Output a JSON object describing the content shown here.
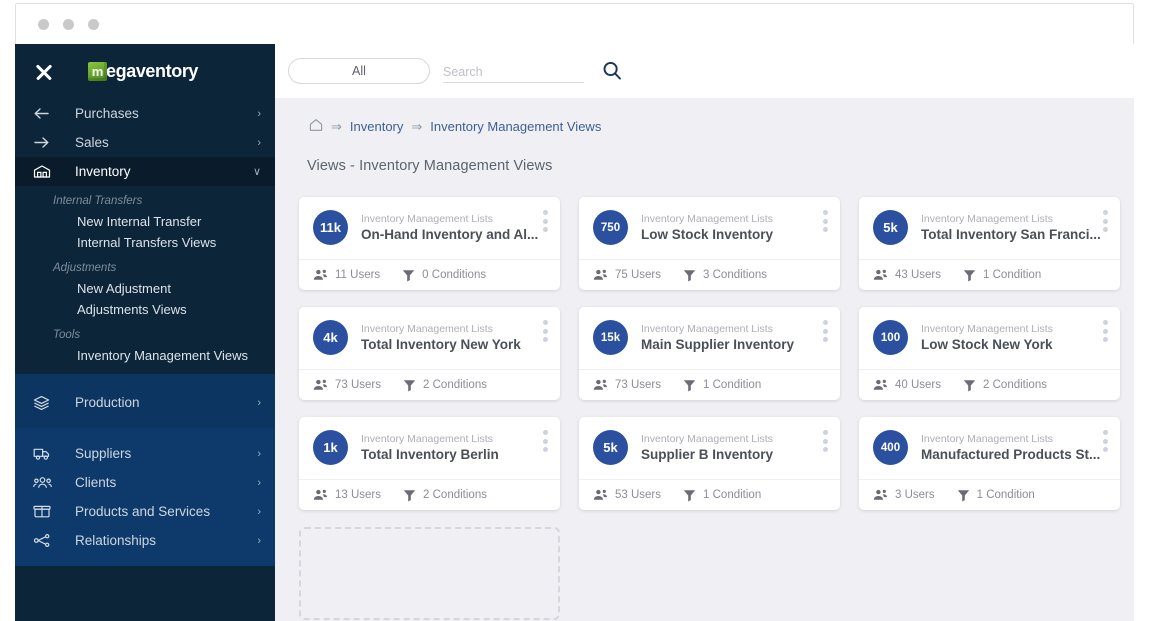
{
  "window": {
    "dots": [
      "window-dot-1",
      "window-dot-2",
      "window-dot-3"
    ]
  },
  "sidebar": {
    "close_label": "close-icon",
    "brand": {
      "mark": "m",
      "name": "egaventory"
    },
    "primary": [
      {
        "label": "Purchases",
        "icon": "arrow-left-icon",
        "chevron": "›",
        "active": false
      },
      {
        "label": "Sales",
        "icon": "arrow-right-icon",
        "chevron": "›",
        "active": false
      },
      {
        "label": "Inventory",
        "icon": "warehouse-icon",
        "chevron": "∨",
        "active": true
      }
    ],
    "groups": [
      {
        "title": "Internal Transfers",
        "items": [
          "New Internal Transfer",
          "Internal Transfers Views"
        ]
      },
      {
        "title": "Adjustments",
        "items": [
          "New Adjustment",
          "Adjustments Views"
        ]
      },
      {
        "title": "Tools",
        "items": [
          "Inventory Management Views"
        ]
      }
    ],
    "secondary": [
      {
        "label": "Production",
        "icon": "layers-icon",
        "chevron": "›"
      }
    ],
    "tertiary": [
      {
        "label": "Suppliers",
        "icon": "truck-icon",
        "chevron": "›"
      },
      {
        "label": "Clients",
        "icon": "people-icon",
        "chevron": "›"
      },
      {
        "label": "Products and Services",
        "icon": "box-icon",
        "chevron": "›"
      },
      {
        "label": "Relationships",
        "icon": "nodes-icon",
        "chevron": "›"
      }
    ]
  },
  "topbar": {
    "filter_label": "All",
    "search_placeholder": "Search",
    "search_value": "",
    "search_icon": "search-icon"
  },
  "breadcrumb": {
    "home_icon": "home-icon",
    "arrow": "⇒",
    "items": [
      {
        "label": "Inventory",
        "current": false
      },
      {
        "label": "Inventory Management Views",
        "current": true
      }
    ]
  },
  "page": {
    "title": "Views - Inventory Management Views"
  },
  "cards": [
    {
      "badge": "11k",
      "category": "Inventory Management Lists",
      "name": "On-Hand Inventory and Al...",
      "users": "11 Users",
      "conditions": "0 Conditions"
    },
    {
      "badge": "750",
      "category": "Inventory Management Lists",
      "name": "Low Stock Inventory",
      "users": "75 Users",
      "conditions": "3 Conditions"
    },
    {
      "badge": "5k",
      "category": "Inventory Management Lists",
      "name": "Total Inventory San Franci...",
      "users": "43 Users",
      "conditions": "1 Condition"
    },
    {
      "badge": "4k",
      "category": "Inventory Management Lists",
      "name": "Total Inventory New York",
      "users": "73 Users",
      "conditions": "2 Conditions"
    },
    {
      "badge": "15k",
      "category": "Inventory Management Lists",
      "name": "Main Supplier Inventory",
      "users": "73 Users",
      "conditions": "1 Condition"
    },
    {
      "badge": "100",
      "category": "Inventory Management Lists",
      "name": "Low Stock New York",
      "users": "40 Users",
      "conditions": "2 Conditions"
    },
    {
      "badge": "1k",
      "category": "Inventory Management Lists",
      "name": "Total Inventory Berlin",
      "users": "13 Users",
      "conditions": "2 Conditions"
    },
    {
      "badge": "5k",
      "category": "Inventory Management Lists",
      "name": "Supplier B Inventory",
      "users": "53 Users",
      "conditions": "1 Condition"
    },
    {
      "badge": "400",
      "category": "Inventory Management Lists",
      "name": "Manufactured Products St...",
      "users": "3 Users",
      "conditions": "1 Condition"
    }
  ],
  "colors": {
    "sidebar_dark": "#0d2538",
    "sidebar_blue": "#0d3561",
    "badge_blue": "#2c50a0",
    "brand_green": "#62a52a",
    "link_blue": "#3b5f96",
    "page_bg": "#f0f0f4"
  }
}
